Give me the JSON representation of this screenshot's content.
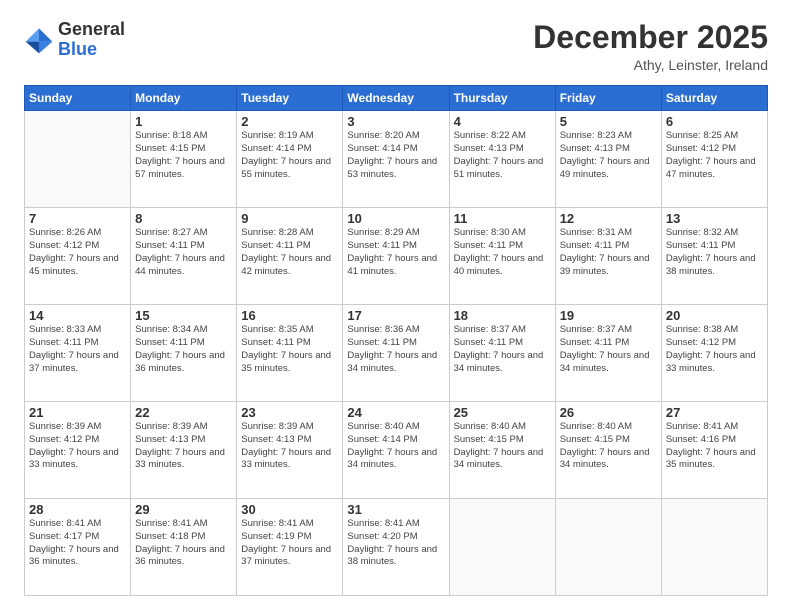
{
  "logo": {
    "general": "General",
    "blue": "Blue"
  },
  "title": "December 2025",
  "location": "Athy, Leinster, Ireland",
  "days_of_week": [
    "Sunday",
    "Monday",
    "Tuesday",
    "Wednesday",
    "Thursday",
    "Friday",
    "Saturday"
  ],
  "weeks": [
    [
      {
        "day": "",
        "sunrise": "",
        "sunset": "",
        "daylight": ""
      },
      {
        "day": "1",
        "sunrise": "Sunrise: 8:18 AM",
        "sunset": "Sunset: 4:15 PM",
        "daylight": "Daylight: 7 hours and 57 minutes."
      },
      {
        "day": "2",
        "sunrise": "Sunrise: 8:19 AM",
        "sunset": "Sunset: 4:14 PM",
        "daylight": "Daylight: 7 hours and 55 minutes."
      },
      {
        "day": "3",
        "sunrise": "Sunrise: 8:20 AM",
        "sunset": "Sunset: 4:14 PM",
        "daylight": "Daylight: 7 hours and 53 minutes."
      },
      {
        "day": "4",
        "sunrise": "Sunrise: 8:22 AM",
        "sunset": "Sunset: 4:13 PM",
        "daylight": "Daylight: 7 hours and 51 minutes."
      },
      {
        "day": "5",
        "sunrise": "Sunrise: 8:23 AM",
        "sunset": "Sunset: 4:13 PM",
        "daylight": "Daylight: 7 hours and 49 minutes."
      },
      {
        "day": "6",
        "sunrise": "Sunrise: 8:25 AM",
        "sunset": "Sunset: 4:12 PM",
        "daylight": "Daylight: 7 hours and 47 minutes."
      }
    ],
    [
      {
        "day": "7",
        "sunrise": "Sunrise: 8:26 AM",
        "sunset": "Sunset: 4:12 PM",
        "daylight": "Daylight: 7 hours and 45 minutes."
      },
      {
        "day": "8",
        "sunrise": "Sunrise: 8:27 AM",
        "sunset": "Sunset: 4:11 PM",
        "daylight": "Daylight: 7 hours and 44 minutes."
      },
      {
        "day": "9",
        "sunrise": "Sunrise: 8:28 AM",
        "sunset": "Sunset: 4:11 PM",
        "daylight": "Daylight: 7 hours and 42 minutes."
      },
      {
        "day": "10",
        "sunrise": "Sunrise: 8:29 AM",
        "sunset": "Sunset: 4:11 PM",
        "daylight": "Daylight: 7 hours and 41 minutes."
      },
      {
        "day": "11",
        "sunrise": "Sunrise: 8:30 AM",
        "sunset": "Sunset: 4:11 PM",
        "daylight": "Daylight: 7 hours and 40 minutes."
      },
      {
        "day": "12",
        "sunrise": "Sunrise: 8:31 AM",
        "sunset": "Sunset: 4:11 PM",
        "daylight": "Daylight: 7 hours and 39 minutes."
      },
      {
        "day": "13",
        "sunrise": "Sunrise: 8:32 AM",
        "sunset": "Sunset: 4:11 PM",
        "daylight": "Daylight: 7 hours and 38 minutes."
      }
    ],
    [
      {
        "day": "14",
        "sunrise": "Sunrise: 8:33 AM",
        "sunset": "Sunset: 4:11 PM",
        "daylight": "Daylight: 7 hours and 37 minutes."
      },
      {
        "day": "15",
        "sunrise": "Sunrise: 8:34 AM",
        "sunset": "Sunset: 4:11 PM",
        "daylight": "Daylight: 7 hours and 36 minutes."
      },
      {
        "day": "16",
        "sunrise": "Sunrise: 8:35 AM",
        "sunset": "Sunset: 4:11 PM",
        "daylight": "Daylight: 7 hours and 35 minutes."
      },
      {
        "day": "17",
        "sunrise": "Sunrise: 8:36 AM",
        "sunset": "Sunset: 4:11 PM",
        "daylight": "Daylight: 7 hours and 34 minutes."
      },
      {
        "day": "18",
        "sunrise": "Sunrise: 8:37 AM",
        "sunset": "Sunset: 4:11 PM",
        "daylight": "Daylight: 7 hours and 34 minutes."
      },
      {
        "day": "19",
        "sunrise": "Sunrise: 8:37 AM",
        "sunset": "Sunset: 4:11 PM",
        "daylight": "Daylight: 7 hours and 34 minutes."
      },
      {
        "day": "20",
        "sunrise": "Sunrise: 8:38 AM",
        "sunset": "Sunset: 4:12 PM",
        "daylight": "Daylight: 7 hours and 33 minutes."
      }
    ],
    [
      {
        "day": "21",
        "sunrise": "Sunrise: 8:39 AM",
        "sunset": "Sunset: 4:12 PM",
        "daylight": "Daylight: 7 hours and 33 minutes."
      },
      {
        "day": "22",
        "sunrise": "Sunrise: 8:39 AM",
        "sunset": "Sunset: 4:13 PM",
        "daylight": "Daylight: 7 hours and 33 minutes."
      },
      {
        "day": "23",
        "sunrise": "Sunrise: 8:39 AM",
        "sunset": "Sunset: 4:13 PM",
        "daylight": "Daylight: 7 hours and 33 minutes."
      },
      {
        "day": "24",
        "sunrise": "Sunrise: 8:40 AM",
        "sunset": "Sunset: 4:14 PM",
        "daylight": "Daylight: 7 hours and 34 minutes."
      },
      {
        "day": "25",
        "sunrise": "Sunrise: 8:40 AM",
        "sunset": "Sunset: 4:15 PM",
        "daylight": "Daylight: 7 hours and 34 minutes."
      },
      {
        "day": "26",
        "sunrise": "Sunrise: 8:40 AM",
        "sunset": "Sunset: 4:15 PM",
        "daylight": "Daylight: 7 hours and 34 minutes."
      },
      {
        "day": "27",
        "sunrise": "Sunrise: 8:41 AM",
        "sunset": "Sunset: 4:16 PM",
        "daylight": "Daylight: 7 hours and 35 minutes."
      }
    ],
    [
      {
        "day": "28",
        "sunrise": "Sunrise: 8:41 AM",
        "sunset": "Sunset: 4:17 PM",
        "daylight": "Daylight: 7 hours and 36 minutes."
      },
      {
        "day": "29",
        "sunrise": "Sunrise: 8:41 AM",
        "sunset": "Sunset: 4:18 PM",
        "daylight": "Daylight: 7 hours and 36 minutes."
      },
      {
        "day": "30",
        "sunrise": "Sunrise: 8:41 AM",
        "sunset": "Sunset: 4:19 PM",
        "daylight": "Daylight: 7 hours and 37 minutes."
      },
      {
        "day": "31",
        "sunrise": "Sunrise: 8:41 AM",
        "sunset": "Sunset: 4:20 PM",
        "daylight": "Daylight: 7 hours and 38 minutes."
      },
      {
        "day": "",
        "sunrise": "",
        "sunset": "",
        "daylight": ""
      },
      {
        "day": "",
        "sunrise": "",
        "sunset": "",
        "daylight": ""
      },
      {
        "day": "",
        "sunrise": "",
        "sunset": "",
        "daylight": ""
      }
    ]
  ]
}
